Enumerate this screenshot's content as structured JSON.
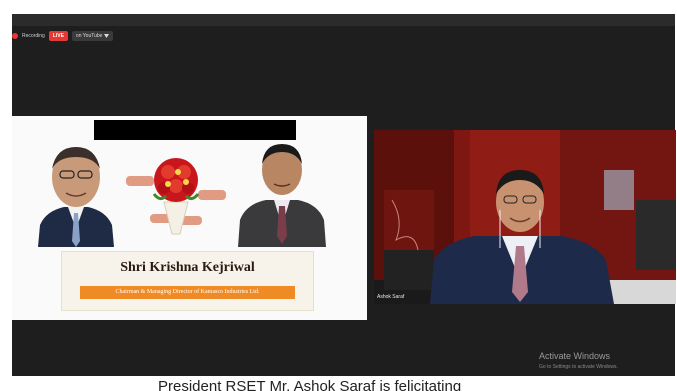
{
  "toolbar": {
    "recording_label": "Recording",
    "live_label": "LIVE",
    "youtube_label": "on YouTube",
    "youtube_chevron": "chevron-down-icon"
  },
  "slide": {
    "honoree_name": "Shri Krishna Kejriwal",
    "designation": "Chairman & Managing Director of Kamasco Industries Ltd."
  },
  "participant": {
    "name": "Ashok Saraf"
  },
  "watermark": {
    "title": "Activate Windows",
    "subtitle": "Go to Settings to activate Windows."
  },
  "caption": {
    "text": "President RSET Mr. Ashok Saraf is felicitating"
  },
  "colors": {
    "live_red": "#e53935",
    "designation_orange": "#f08a24",
    "video_background": "#7e1712",
    "window_dark": "#1e1e1e"
  }
}
